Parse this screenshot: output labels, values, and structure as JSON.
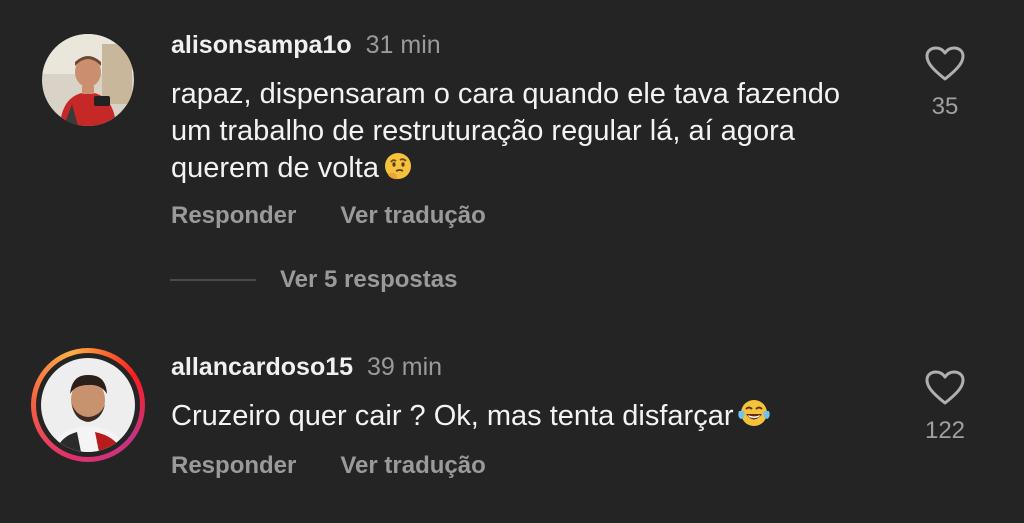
{
  "comments": [
    {
      "username": "alisonsampa1o",
      "time": "31 min",
      "text_lines": [
        "rapaz, dispensaram o cara quando ele tava fazendo",
        "um trabalho de restruturação regular lá, aí agora",
        "querem de volta"
      ],
      "emoji": "thinking-face",
      "reply_label": "Responder",
      "translate_label": "Ver tradução",
      "likes": "35",
      "view_replies": "Ver 5 respostas",
      "avatar_story_ring": false
    },
    {
      "username": "allancardoso15",
      "time": "39 min",
      "text": "Cruzeiro quer cair ? Ok, mas  tenta disfarçar",
      "emoji": "face-with-tears-of-joy",
      "reply_label": "Responder",
      "translate_label": "Ver tradução",
      "likes": "122",
      "avatar_story_ring": true
    }
  ],
  "colors": {
    "background": "#242424",
    "text": "#f3f3f3",
    "muted": "#9a9a9a"
  }
}
